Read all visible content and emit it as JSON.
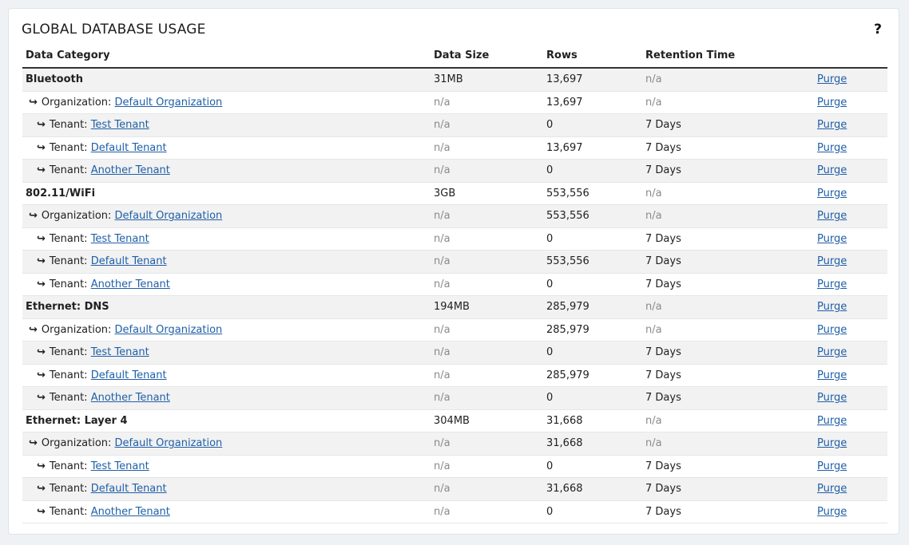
{
  "page": {
    "title": "GLOBAL DATABASE USAGE",
    "help_label": "?"
  },
  "table": {
    "headers": [
      "Data Category",
      "Data Size",
      "Rows",
      "Retention Time",
      ""
    ],
    "action_label": "Purge",
    "rows": [
      {
        "level": "category",
        "name": "Bluetooth",
        "size": "31MB",
        "rows": "13,697",
        "retention": "n/a"
      },
      {
        "level": "org",
        "prefix": "Organization: ",
        "name": "Default Organization",
        "size": "n/a",
        "rows": "13,697",
        "retention": "n/a"
      },
      {
        "level": "tenant",
        "prefix": "Tenant: ",
        "name": "Test Tenant",
        "size": "n/a",
        "rows": "0",
        "retention": "7 Days"
      },
      {
        "level": "tenant",
        "prefix": "Tenant: ",
        "name": "Default Tenant",
        "size": "n/a",
        "rows": "13,697",
        "retention": "7 Days"
      },
      {
        "level": "tenant",
        "prefix": "Tenant: ",
        "name": "Another Tenant",
        "size": "n/a",
        "rows": "0",
        "retention": "7 Days"
      },
      {
        "level": "category",
        "name": "802.11/WiFi",
        "size": "3GB",
        "rows": "553,556",
        "retention": "n/a"
      },
      {
        "level": "org",
        "prefix": "Organization: ",
        "name": "Default Organization",
        "size": "n/a",
        "rows": "553,556",
        "retention": "n/a"
      },
      {
        "level": "tenant",
        "prefix": "Tenant: ",
        "name": "Test Tenant",
        "size": "n/a",
        "rows": "0",
        "retention": "7 Days"
      },
      {
        "level": "tenant",
        "prefix": "Tenant: ",
        "name": "Default Tenant",
        "size": "n/a",
        "rows": "553,556",
        "retention": "7 Days"
      },
      {
        "level": "tenant",
        "prefix": "Tenant: ",
        "name": "Another Tenant",
        "size": "n/a",
        "rows": "0",
        "retention": "7 Days"
      },
      {
        "level": "category",
        "name": "Ethernet: DNS",
        "size": "194MB",
        "rows": "285,979",
        "retention": "n/a"
      },
      {
        "level": "org",
        "prefix": "Organization: ",
        "name": "Default Organization",
        "size": "n/a",
        "rows": "285,979",
        "retention": "n/a"
      },
      {
        "level": "tenant",
        "prefix": "Tenant: ",
        "name": "Test Tenant",
        "size": "n/a",
        "rows": "0",
        "retention": "7 Days"
      },
      {
        "level": "tenant",
        "prefix": "Tenant: ",
        "name": "Default Tenant",
        "size": "n/a",
        "rows": "285,979",
        "retention": "7 Days"
      },
      {
        "level": "tenant",
        "prefix": "Tenant: ",
        "name": "Another Tenant",
        "size": "n/a",
        "rows": "0",
        "retention": "7 Days"
      },
      {
        "level": "category",
        "name": "Ethernet: Layer 4",
        "size": "304MB",
        "rows": "31,668",
        "retention": "n/a"
      },
      {
        "level": "org",
        "prefix": "Organization: ",
        "name": "Default Organization",
        "size": "n/a",
        "rows": "31,668",
        "retention": "n/a"
      },
      {
        "level": "tenant",
        "prefix": "Tenant: ",
        "name": "Test Tenant",
        "size": "n/a",
        "rows": "0",
        "retention": "7 Days"
      },
      {
        "level": "tenant",
        "prefix": "Tenant: ",
        "name": "Default Tenant",
        "size": "n/a",
        "rows": "31,668",
        "retention": "7 Days"
      },
      {
        "level": "tenant",
        "prefix": "Tenant: ",
        "name": "Another Tenant",
        "size": "n/a",
        "rows": "0",
        "retention": "7 Days"
      }
    ]
  }
}
